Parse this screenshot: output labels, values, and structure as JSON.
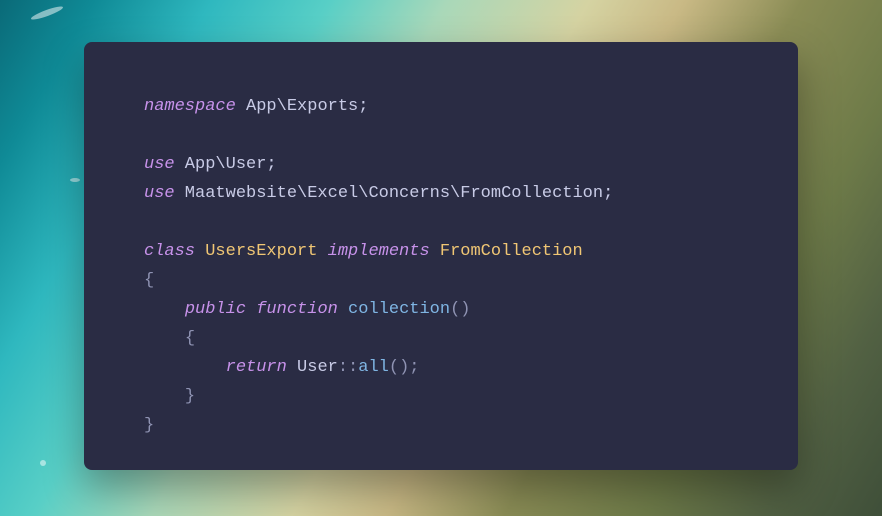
{
  "code": {
    "l1": {
      "kw": "namespace",
      "rest": " App\\Exports;"
    },
    "l2": {
      "kw": "use",
      "rest": " App\\User;"
    },
    "l3": {
      "kw": "use",
      "rest": " Maatwebsite\\Excel\\Concerns\\FromCollection;"
    },
    "l4": {
      "kw1": "class",
      "name": " UsersExport ",
      "kw2": "implements",
      "impl": " FromCollection"
    },
    "l5": "{",
    "l6": {
      "indent": "    ",
      "kw1": "public",
      "sp": " ",
      "kw2": "function",
      "fn": " collection",
      "rest": "()"
    },
    "l7": {
      "indent": "    ",
      "brace": "{"
    },
    "l8": {
      "indent": "        ",
      "kw": "return",
      "cls": " User",
      "op": "::",
      "call": "all",
      "rest": "();"
    },
    "l9": {
      "indent": "    ",
      "brace": "}"
    },
    "l10": "}"
  }
}
